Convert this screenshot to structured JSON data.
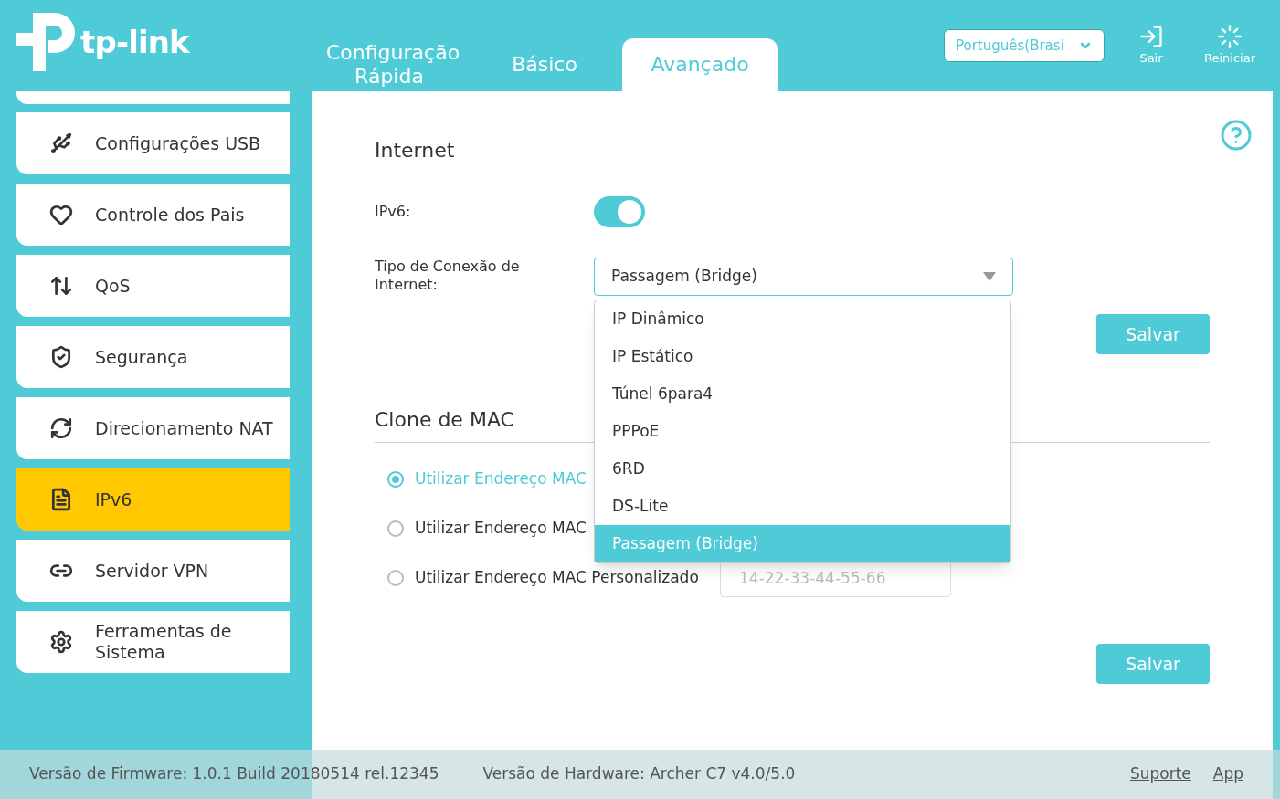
{
  "header": {
    "logo": "tp-link",
    "tabs": [
      {
        "label": "Configuração Rápida",
        "selected": false
      },
      {
        "label": "Básico",
        "selected": false
      },
      {
        "label": "Avançado",
        "selected": true
      }
    ],
    "language": "Português(Brasi",
    "actions": [
      {
        "label": "Sair"
      },
      {
        "label": "Reiniciar"
      }
    ]
  },
  "sidebar": {
    "items": [
      {
        "label": "Configurações USB",
        "selected": false
      },
      {
        "label": "Controle dos Pais",
        "selected": false
      },
      {
        "label": "QoS",
        "selected": false
      },
      {
        "label": "Segurança",
        "selected": false
      },
      {
        "label": "Direcionamento NAT",
        "selected": false
      },
      {
        "label": "IPv6",
        "selected": true
      },
      {
        "label": "Servidor VPN",
        "selected": false
      },
      {
        "label": "Ferramentas de Sistema",
        "selected": false
      }
    ]
  },
  "internet": {
    "title": "Internet",
    "ipv6_label": "IPv6:",
    "ipv6_on": true,
    "connection_label": "Tipo de Conexão de Internet:",
    "connection_value": "Passagem (Bridge)",
    "options": [
      {
        "label": "IP Dinâmico",
        "selected": false
      },
      {
        "label": "IP Estático",
        "selected": false
      },
      {
        "label": "Túnel 6para4",
        "selected": false
      },
      {
        "label": "PPPoE",
        "selected": false
      },
      {
        "label": "6RD",
        "selected": false
      },
      {
        "label": "DS-Lite",
        "selected": false
      },
      {
        "label": "Passagem (Bridge)",
        "selected": true
      }
    ],
    "save": "Salvar"
  },
  "mac_clone": {
    "title": "Clone de MAC",
    "options": [
      {
        "label": "Utilizar Endereço MAC",
        "selected": true
      },
      {
        "label": "Utilizar Endereço MAC",
        "selected": false
      },
      {
        "label": "Utilizar Endereço MAC Personalizado",
        "selected": false,
        "placeholder": "14-22-33-44-55-66"
      }
    ],
    "save": "Salvar"
  },
  "footer": {
    "firmware": "Versão de Firmware: 1.0.1 Build 20180514 rel.12345",
    "hardware": "Versão de Hardware: Archer C7 v4.0/5.0",
    "links": [
      "Suporte",
      "App"
    ]
  }
}
